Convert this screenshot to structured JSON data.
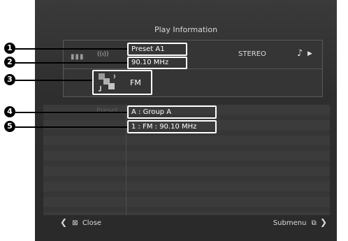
{
  "title": "Play Information",
  "header": {
    "signal_indicator": "((ı))",
    "mode": "STEREO",
    "status_icons": [
      "music-note-icon",
      "play-icon"
    ]
  },
  "station": {
    "preset": "Preset A1",
    "frequency": "90.10  MHz",
    "band": "FM",
    "band_icon": "tuner-icon"
  },
  "list": {
    "label": "Preset",
    "group": "A : Group A",
    "entry": "1 : FM : 90.10  MHz"
  },
  "footer": {
    "close_label": "Close",
    "submenu_label": "Submenu"
  },
  "callouts": [
    "1",
    "2",
    "3",
    "4",
    "5"
  ],
  "colors": {
    "screen_bg": "#2e2e2e",
    "highlight_border": "#ffffff",
    "callout_bg": "#000000"
  }
}
